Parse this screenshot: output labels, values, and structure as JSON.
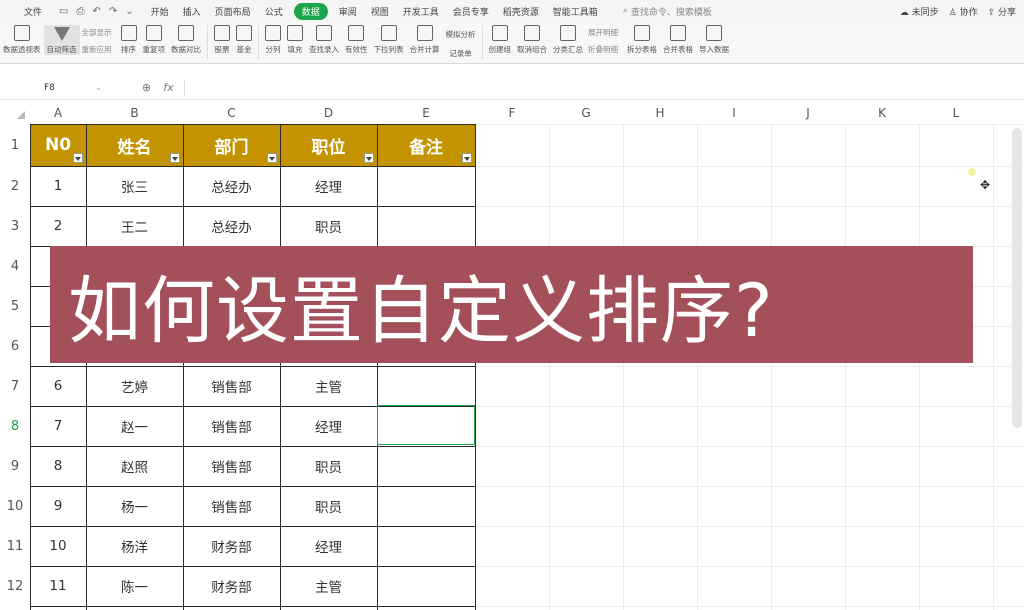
{
  "menubar": {
    "file": "文件",
    "items": [
      "开始",
      "插入",
      "页面布局",
      "公式",
      "数据",
      "审阅",
      "视图",
      "开发工具",
      "会员专享",
      "稻壳资源",
      "智能工具箱"
    ],
    "active_index": 4,
    "search": "查找命令、搜索模板",
    "sync": "未同步",
    "collab": "协作",
    "share": "分享"
  },
  "ribbon": {
    "buttons": [
      {
        "label": "数据透视表",
        "icon": "pivot-table-icon"
      },
      {
        "label": "自动筛选",
        "icon": "filter-icon"
      },
      {
        "label": "排序",
        "icon": "sort-icon"
      },
      {
        "label": "重复项",
        "icon": "duplicate-icon"
      },
      {
        "label": "数据对比",
        "icon": "compare-icon"
      },
      {
        "label": "股票",
        "icon": "stock-icon"
      },
      {
        "label": "基金",
        "icon": "fund-icon"
      },
      {
        "label": "分列",
        "icon": "split-icon"
      },
      {
        "label": "填充",
        "icon": "fill-icon"
      },
      {
        "label": "查找录入",
        "icon": "lookup-icon"
      },
      {
        "label": "有效性",
        "icon": "validation-icon"
      },
      {
        "label": "下拉列表",
        "icon": "dropdown-list-icon"
      },
      {
        "label": "合并计算",
        "icon": "consolidate-icon"
      },
      {
        "label": "记录单",
        "icon": "record-icon"
      },
      {
        "label": "创建组",
        "icon": "group-icon"
      },
      {
        "label": "取消组合",
        "icon": "ungroup-icon"
      },
      {
        "label": "分类汇总",
        "icon": "subtotal-icon"
      },
      {
        "label": "拆分表格",
        "icon": "split-table-icon"
      },
      {
        "label": "合并表格",
        "icon": "merge-table-icon"
      },
      {
        "label": "导入数据",
        "icon": "import-icon"
      }
    ],
    "filter_all": "全部显示",
    "filter_reapply": "重新应用",
    "simulate": "模拟分析",
    "expand": "展开明细",
    "collapse": "折叠明细"
  },
  "formula_bar": {
    "cell_ref": "F8",
    "fx": "fx",
    "value": ""
  },
  "columns": [
    "A",
    "B",
    "C",
    "D",
    "E",
    "F",
    "G",
    "H",
    "I",
    "J",
    "K",
    "L"
  ],
  "rows": [
    "1",
    "2",
    "3",
    "4",
    "5",
    "6",
    "7",
    "8",
    "9",
    "10",
    "11",
    "12"
  ],
  "active_row": "8",
  "table": {
    "headers": [
      "N0",
      "姓名",
      "部门",
      "职位",
      "备注"
    ],
    "rows": [
      {
        "row": 2,
        "no": "1",
        "name": "张三",
        "dept": "总经办",
        "pos": "经理",
        "note": ""
      },
      {
        "row": 3,
        "no": "2",
        "name": "王二",
        "dept": "总经办",
        "pos": "职员",
        "note": ""
      },
      {
        "row": 7,
        "no": "6",
        "name": "艺婷",
        "dept": "销售部",
        "pos": "主管",
        "note": ""
      },
      {
        "row": 8,
        "no": "7",
        "name": "赵一",
        "dept": "销售部",
        "pos": "经理",
        "note": ""
      },
      {
        "row": 9,
        "no": "8",
        "name": "赵照",
        "dept": "销售部",
        "pos": "职员",
        "note": ""
      },
      {
        "row": 10,
        "no": "9",
        "name": "杨一",
        "dept": "销售部",
        "pos": "职员",
        "note": ""
      },
      {
        "row": 11,
        "no": "10",
        "name": "杨洋",
        "dept": "财务部",
        "pos": "经理",
        "note": ""
      },
      {
        "row": 12,
        "no": "11",
        "name": "陈一",
        "dept": "财务部",
        "pos": "主管",
        "note": ""
      }
    ]
  },
  "banner": {
    "text": "如何设置自定义排序?",
    "bg_color": "#a4505a",
    "text_color": "#ffffff"
  },
  "colors": {
    "header_fill": "#c39300",
    "accent": "#1aa64a"
  }
}
